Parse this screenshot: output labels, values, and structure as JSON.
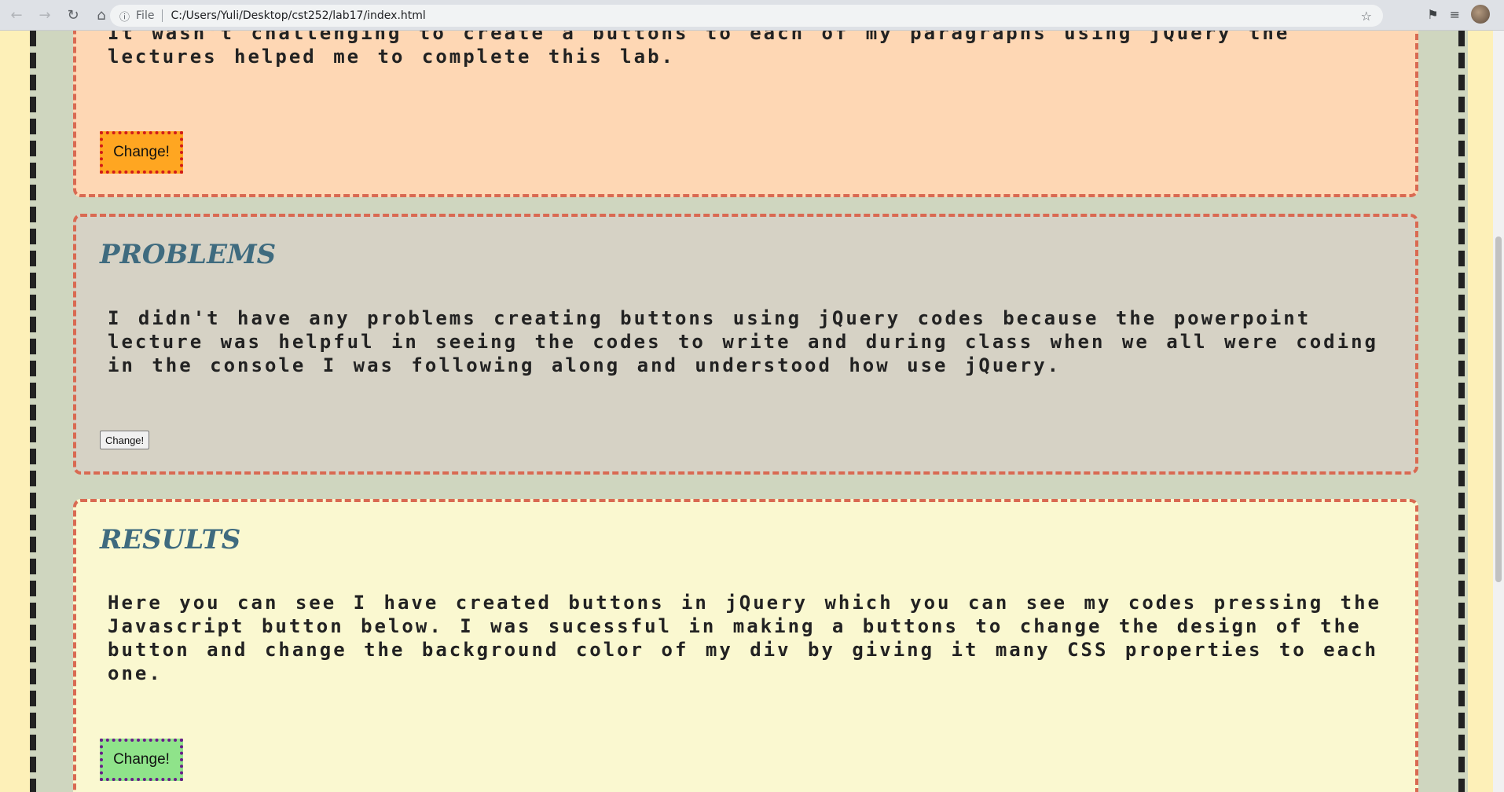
{
  "browser": {
    "scheme_label": "File",
    "url": "C:/Users/Yuli/Desktop/cst252/lab17/index.html"
  },
  "sections": {
    "first": {
      "text": "It wasn't challenging to create a buttons to each of my paragraphs using jQuery the lectures helped me to complete this lab.",
      "button_label": "Change!"
    },
    "problems": {
      "title": "PROBLEMS",
      "text": "I didn't have any problems creating buttons using jQuery codes because the powerpoint lecture was helpful in seeing the codes to write and during class when we all were coding in the console I was following along and understood how use jQuery.",
      "button_label": "Change!"
    },
    "results": {
      "title": "RESULTS",
      "text": "Here you can see I have created buttons in jQuery which you can see my codes pressing the Javascript button below. I was sucessful in making a buttons to change the design of the button and change the background color of my div by giving it many CSS properties to each one.",
      "button_label": "Change!"
    }
  },
  "colors": {
    "section_border": "#d96a52",
    "first_bg": "#fed7b4",
    "problems_bg": "#d6d2c5",
    "results_bg": "#faf8d0",
    "title": "#3f6b7f"
  }
}
